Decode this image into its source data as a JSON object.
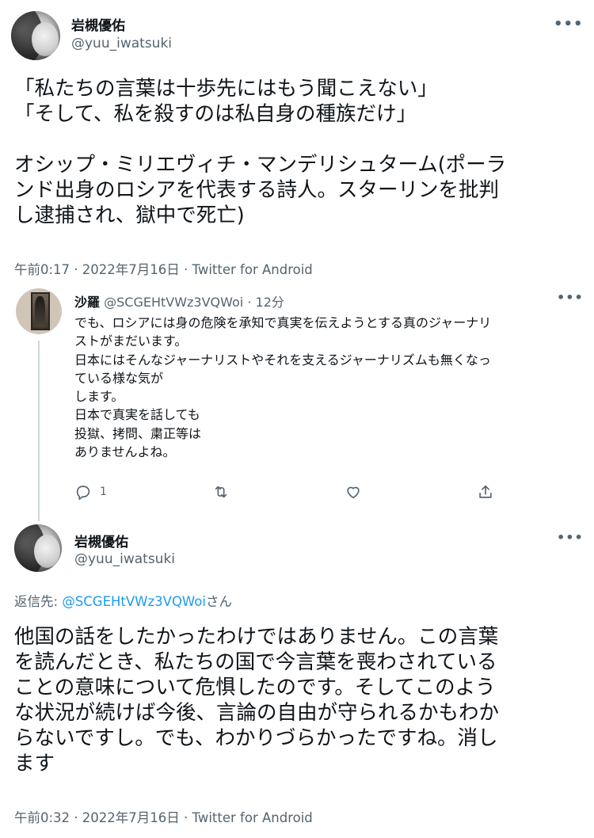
{
  "tweet1": {
    "name": "岩槻優佑",
    "handle": "@yuu_iwatsuki",
    "more": "•••",
    "text": "「私たちの言葉は十歩先にはもう聞こえない」\n「そして、私を殺すのは私自身の種族だけ」\n\nオシップ・ミリエヴィチ・マンデリシュターム(ポーラ\nンド出身のロシアを代表する詩人。スターリンを批判\nし逮捕され、獄中で死亡)",
    "meta": "午前0:17 · 2022年7月16日 · Twitter for Android"
  },
  "reply": {
    "name": "沙羅",
    "handle": "@SCGEHtVWz3VQWoi",
    "time": "· 12分",
    "more": "•••",
    "text": "でも、ロシアには身の危険を承知で真実を伝えようとする真のジャーナリ\nストがまだいます。\n日本にはそんなジャーナリストやそれを支えるジャーナリズムも無くなっ\nている様な気が\nします。\n日本で真実を話しても\n投獄、拷問、粛正等は\nありませんよね。",
    "actions": {
      "reply_count": "1",
      "reply_icon": "reply-icon",
      "retweet_icon": "retweet-icon",
      "like_icon": "heart-icon",
      "share_icon": "share-icon"
    }
  },
  "tweet2": {
    "name": "岩槻優佑",
    "handle": "@yuu_iwatsuki",
    "more": "•••",
    "replyto_prefix": "返信先: ",
    "replyto_mention": "@SCGEHtVWz3VQWoi",
    "replyto_suffix": "さん",
    "text": "他国の話をしたかったわけではありません。この言葉\nを読んだとき、私たちの国で今言葉を喪わされている\nことの意味について危惧したのです。そしてこのよう\nな状況が続けば今後、言論の自由が守られるかもわか\nらないですし。でも、わかりづらかったですね。消し\nます",
    "meta": "午前0:32 · 2022年7月16日 · Twitter for Android"
  },
  "colors": {
    "text": "#0f1419",
    "secondary": "#536471",
    "link": "#1d9bf0",
    "thread_line": "#cfd9de"
  }
}
